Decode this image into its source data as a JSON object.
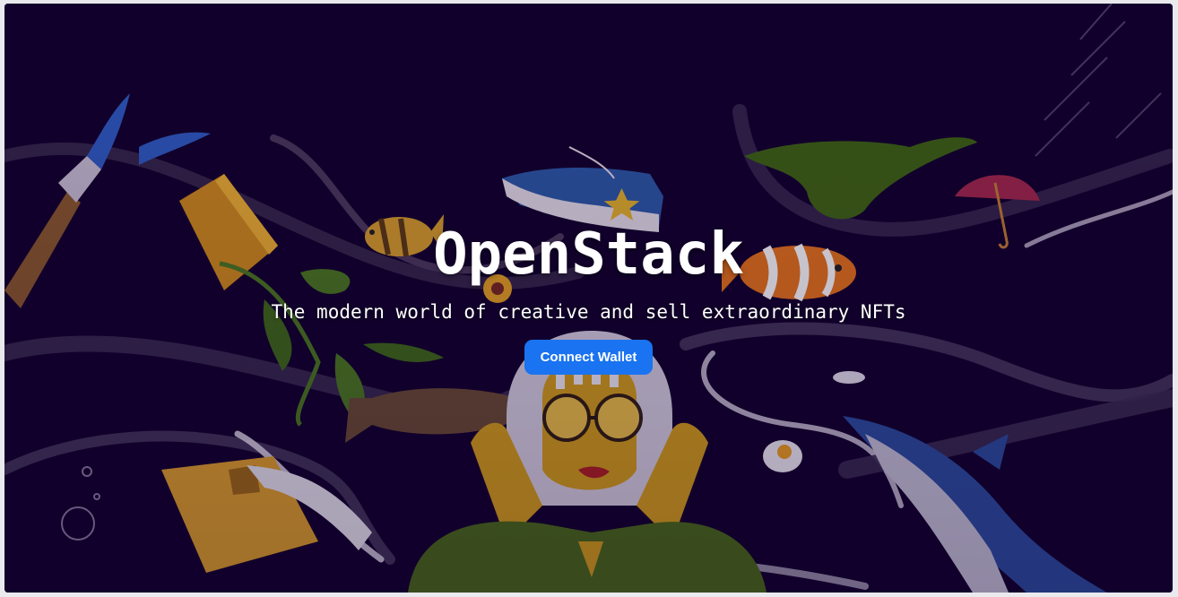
{
  "hero": {
    "title": "OpenStack",
    "subtitle": "The modern world of creative and sell extraordinary NFTs",
    "cta_label": "Connect Wallet"
  },
  "colors": {
    "background": "#12002b",
    "button": "#1a73f0",
    "text": "#ffffff"
  }
}
